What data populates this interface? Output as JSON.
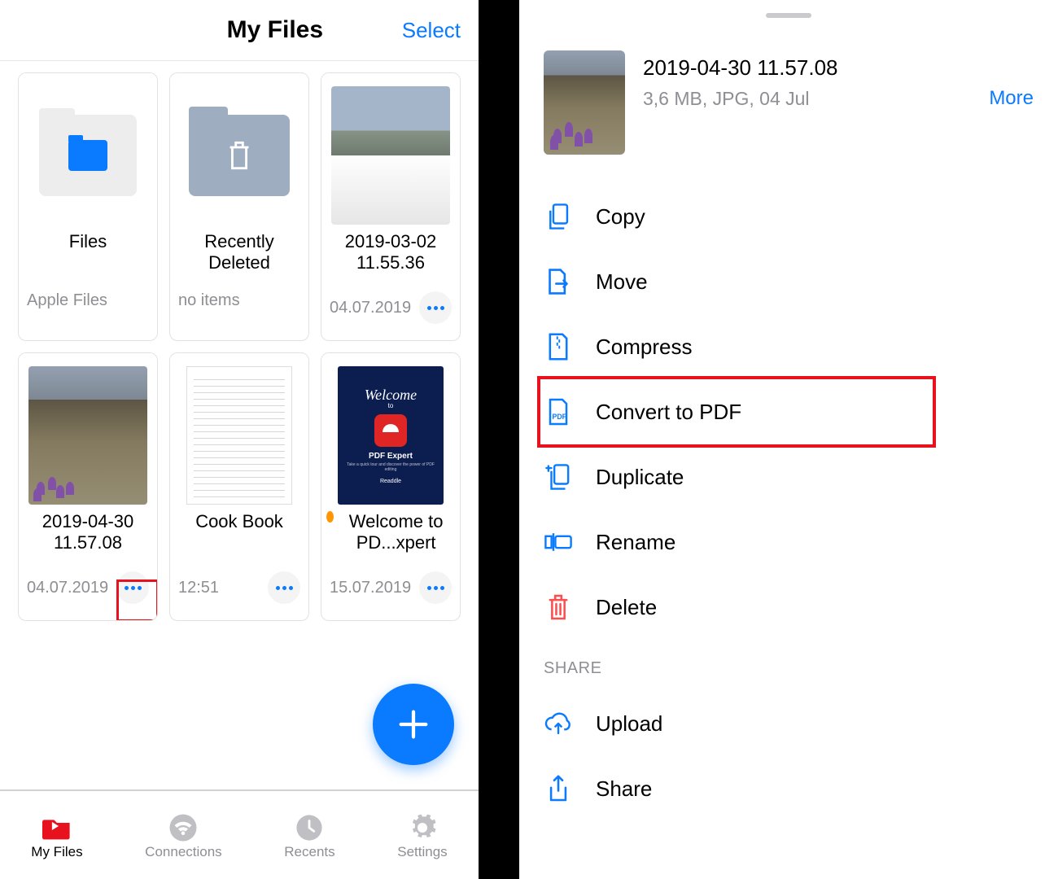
{
  "left": {
    "header": {
      "title": "My Files",
      "select": "Select"
    },
    "tiles": [
      {
        "title": "Files",
        "meta": "Apple Files"
      },
      {
        "title": "Recently Deleted",
        "meta": "no items"
      },
      {
        "title": "2019-03-02 11.55.36",
        "meta": "04.07.2019"
      },
      {
        "title": "2019-04-30 11.57.08",
        "meta": "04.07.2019"
      },
      {
        "title": "Cook Book",
        "meta": "12:51"
      },
      {
        "title": " Welcome to PD...xpert",
        "meta": "15.07.2019"
      }
    ],
    "tabs": [
      {
        "label": "My Files"
      },
      {
        "label": "Connections"
      },
      {
        "label": "Recents"
      },
      {
        "label": "Settings"
      }
    ]
  },
  "right": {
    "title": "2019-04-30 11.57.08",
    "meta": "3,6 MB, JPG, 04 Jul",
    "more": "More",
    "actions": [
      {
        "label": "Copy"
      },
      {
        "label": "Move"
      },
      {
        "label": "Compress"
      },
      {
        "label": "Convert to PDF"
      },
      {
        "label": "Duplicate"
      },
      {
        "label": "Rename"
      },
      {
        "label": "Delete"
      }
    ],
    "shareHeader": "SHARE",
    "shareActions": [
      {
        "label": "Upload"
      },
      {
        "label": "Share"
      }
    ]
  },
  "pdfTile": {
    "welcome": "Welcome",
    "to": "to",
    "expert": "PDF Expert",
    "sub": "Take a quick tour and discover the power of PDF editing",
    "readdle": "Readdle"
  }
}
